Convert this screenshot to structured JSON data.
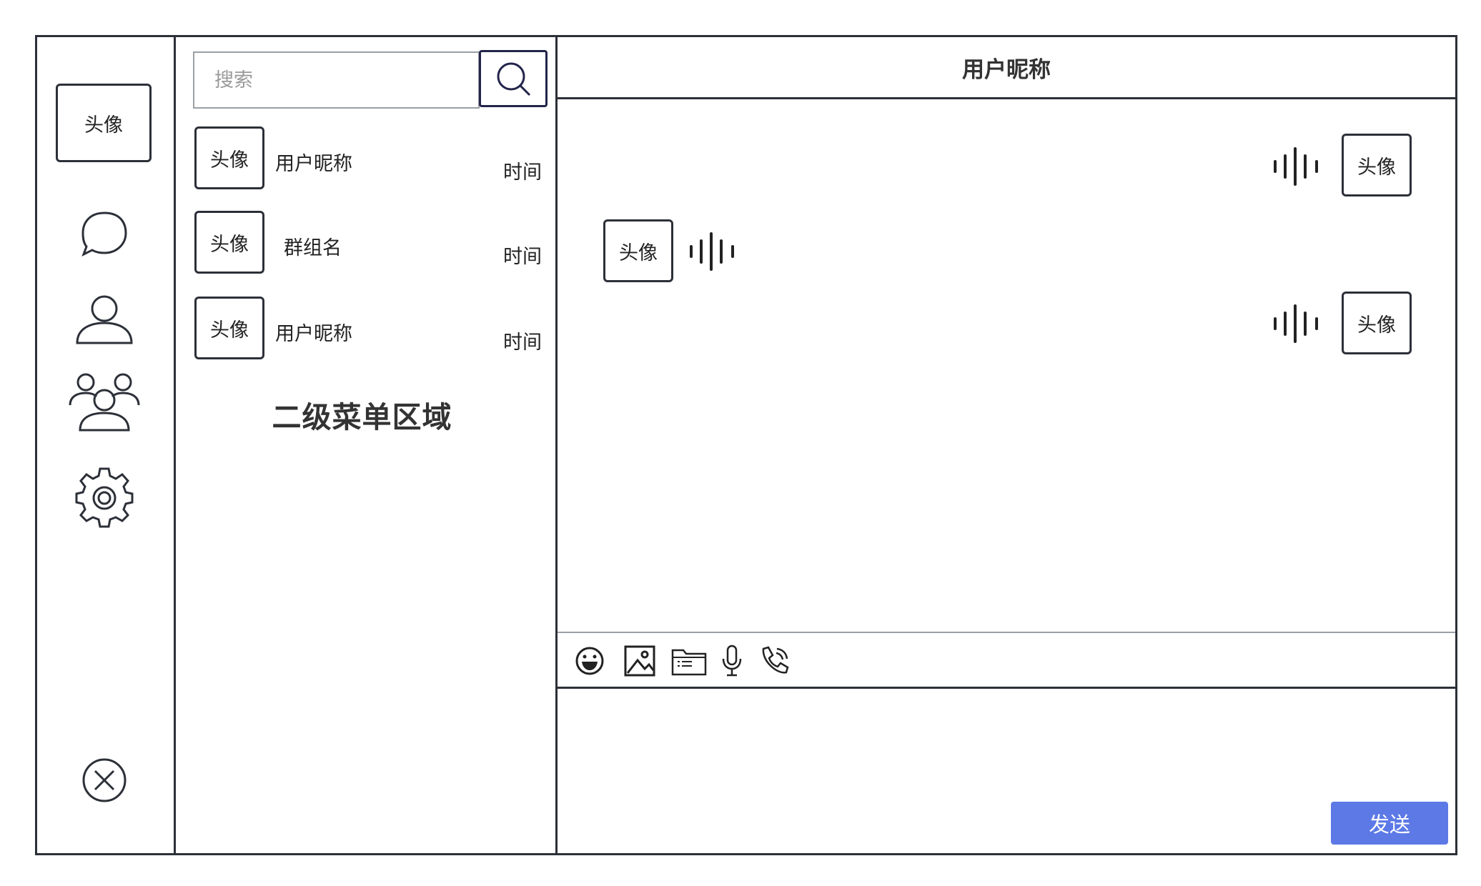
{
  "sidebar": {
    "avatar_label": "头像",
    "icons": [
      "chat-bubble-icon",
      "user-icon",
      "group-icon",
      "settings-gear-icon",
      "close-circle-icon"
    ]
  },
  "menu": {
    "search_placeholder": "搜索",
    "conversations": [
      {
        "avatar": "头像",
        "name": "用户昵称",
        "time": "时间"
      },
      {
        "avatar": "头像",
        "name": "群组名",
        "time": "时间"
      },
      {
        "avatar": "头像",
        "name": "用户昵称",
        "time": "时间"
      }
    ],
    "area_caption": "二级菜单区域"
  },
  "chat": {
    "title": "用户昵称",
    "messages": [
      {
        "side": "right",
        "type": "voice",
        "avatar": "头像"
      },
      {
        "side": "left",
        "type": "voice",
        "avatar": "头像"
      },
      {
        "side": "right",
        "type": "voice",
        "avatar": "头像"
      }
    ],
    "toolbar": [
      "emoji-icon",
      "image-icon",
      "folder-icon",
      "microphone-icon",
      "phone-call-icon"
    ],
    "send_label": "发送"
  },
  "colors": {
    "border": "#2c3038",
    "send_button": "#5c79e6",
    "search_button_border": "#23254a"
  }
}
